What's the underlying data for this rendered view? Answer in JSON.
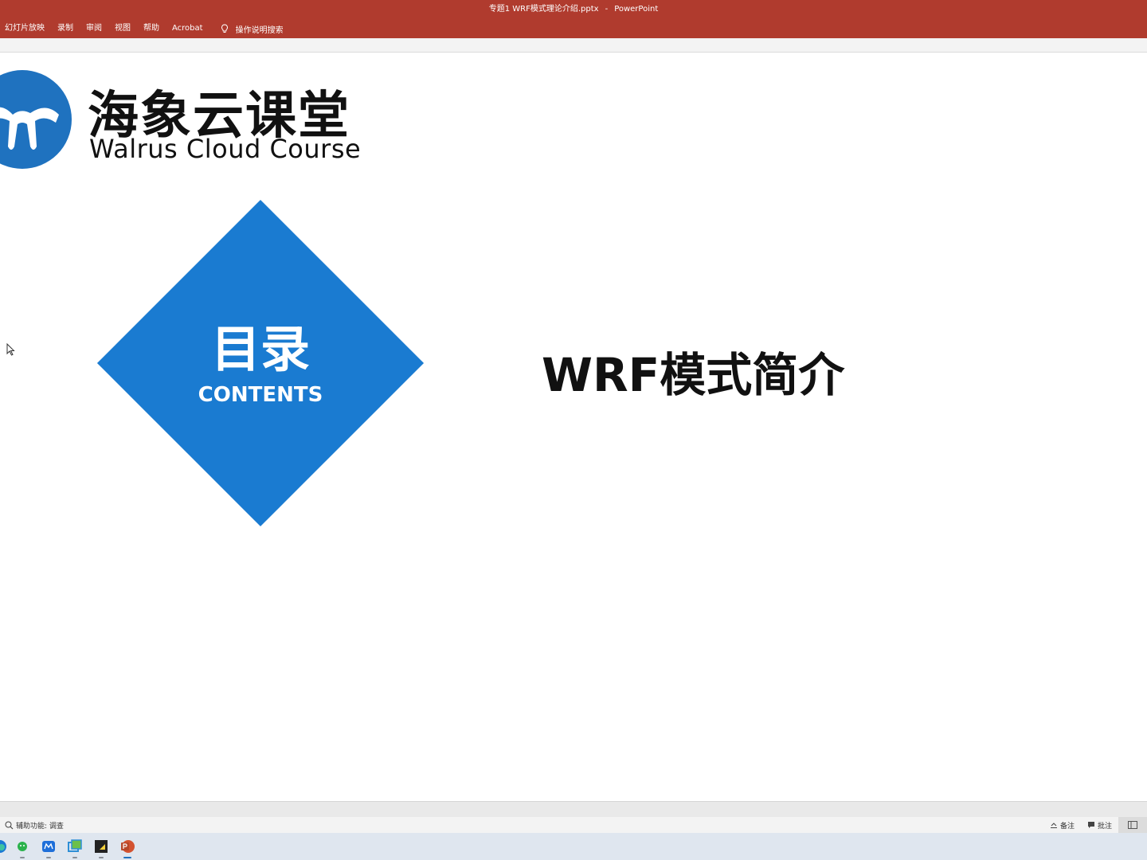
{
  "window": {
    "document_title": "专题1 WRF模式理论介绍.pptx",
    "separator": "-",
    "app_name": "PowerPoint"
  },
  "ribbon": {
    "tabs": [
      "幻灯片放映",
      "录制",
      "审阅",
      "视图",
      "帮助",
      "Acrobat"
    ],
    "search_label": "操作说明搜索"
  },
  "slide": {
    "brand_cn": "海象云课堂",
    "brand_en": "Walrus Cloud Course",
    "diamond_cn": "目录",
    "diamond_en": "CONTENTS",
    "section_title": "WRF模式简介"
  },
  "statusbar": {
    "accessibility": "辅助功能: 调查",
    "notes": "备注",
    "comments": "批注"
  },
  "taskbar": {
    "apps": [
      "edge-icon",
      "wechat-icon",
      "mail-icon",
      "remote-desktop-icon",
      "sticky-notes-icon",
      "powerpoint-icon"
    ]
  },
  "colors": {
    "ribbon": "#b03b2e",
    "accent_blue": "#1a7bd1",
    "logo_blue": "#1f72bf",
    "text_dark": "#111111"
  }
}
